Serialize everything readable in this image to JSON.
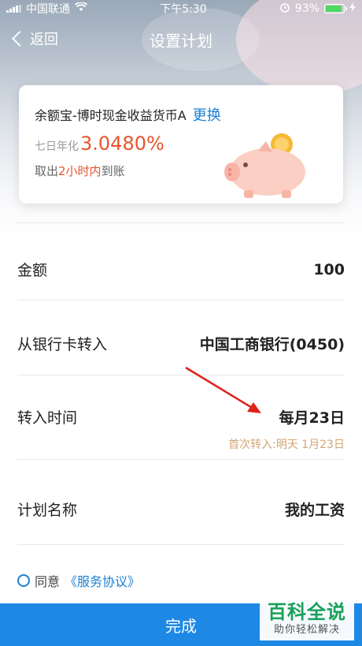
{
  "status_bar": {
    "carrier": "中国联通",
    "time": "下午5:30",
    "battery": "93%",
    "battery_level": 0.93
  },
  "nav": {
    "back_label": "返回",
    "title": "设置计划"
  },
  "fund_card": {
    "name": "余额宝-博时现金收益货币A",
    "change_label": "更换",
    "yield_label": "七日年化",
    "yield_value": "3.0480%",
    "arrival_prefix": "取出",
    "arrival_highlight": "2小时内",
    "arrival_suffix": "到账"
  },
  "form": {
    "amount_label": "金额",
    "amount_value": "100",
    "bank_label": "从银行卡转入",
    "bank_value": "中国工商银行(0450)",
    "time_label": "转入时间",
    "time_value": "每月23日",
    "first_transfer_note": "首次转入:明天 1月23日",
    "plan_name_label": "计划名称",
    "plan_name_value": "我的工资"
  },
  "agreement": {
    "prefix": "同意",
    "link": "《服务协议》"
  },
  "done_button": "完成",
  "watermark": {
    "main": "百科全说",
    "sub": "助你轻松解决"
  },
  "colors": {
    "accent_blue": "#1e88e5",
    "yield_orange": "#e8542f",
    "note_gold": "#d2a673",
    "watermark_green": "#19a05a",
    "annotation_red": "#e0201a"
  }
}
